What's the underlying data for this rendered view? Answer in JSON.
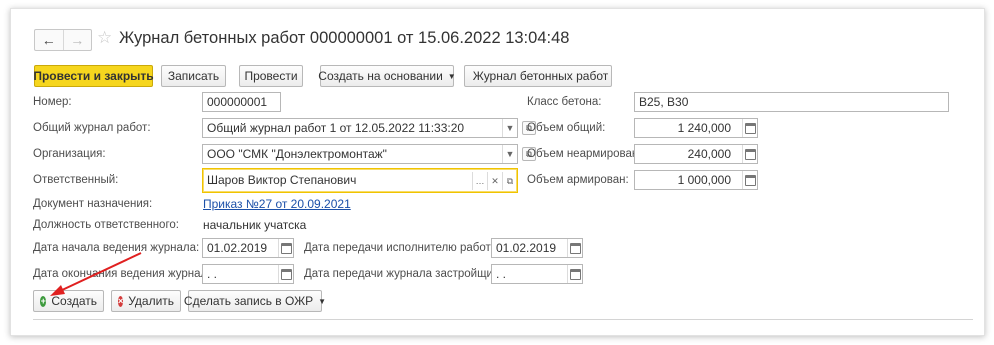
{
  "header": {
    "back_icon": "arrow-left-icon",
    "forward_icon": "arrow-right-icon",
    "favorite_icon": "star-icon",
    "title": "Журнал бетонных работ 000000001 от 15.06.2022 13:04:48"
  },
  "toolbar": {
    "post_close": "Провести и закрыть",
    "save": "Записать",
    "post": "Провести",
    "create_based": "Создать на основании",
    "print": "Журнал бетонных работ"
  },
  "form": {
    "number_label": "Номер:",
    "number_value": "000000001",
    "general_journal_label": "Общий журнал работ:",
    "general_journal_value": "Общий журнал работ 1 от 12.05.2022 11:33:20",
    "organization_label": "Организация:",
    "organization_value": "ООО \"СМК \"Донэлектромонтаж\"",
    "responsible_label": "Ответственный:",
    "responsible_value": "Шаров Виктор Степанович",
    "appointment_doc_label": "Документ назначения:",
    "appointment_doc_value": "Приказ №27 от 20.09.2021",
    "position_label": "Должность ответственного:",
    "position_value": "начальник учатска",
    "start_date_label": "Дата начала ведения журнала:",
    "start_date_value": "01.02.2019",
    "end_date_label": "Дата окончания ведения журнала:",
    "end_date_value": " .  .",
    "transfer_executor_label": "Дата передачи исполнителю работ:",
    "transfer_executor_value": "01.02.2019",
    "transfer_developer_label": "Дата передачи журнала застройщику:",
    "transfer_developer_value": " .  .",
    "concrete_class_label": "Класс бетона:",
    "concrete_class_value": "B25, B30",
    "volume_total_label": "Объем общий:",
    "volume_total_value": "1 240,000",
    "volume_unreinforced_label": "Объем неармирован:",
    "volume_unreinforced_value": "240,000",
    "volume_reinforced_label": "Объем армирован:",
    "volume_reinforced_value": "1 000,000"
  },
  "bottom": {
    "create": "Создать",
    "delete": "Удалить",
    "make_record": "Сделать запись в ОЖР"
  },
  "colors": {
    "primary_button": "#f6d61e",
    "link": "#1c50a8",
    "focus_border": "#f0c400",
    "create_icon": "#3d9a3d",
    "delete_icon": "#d33b3b",
    "annotation_arrow": "#e02020"
  }
}
